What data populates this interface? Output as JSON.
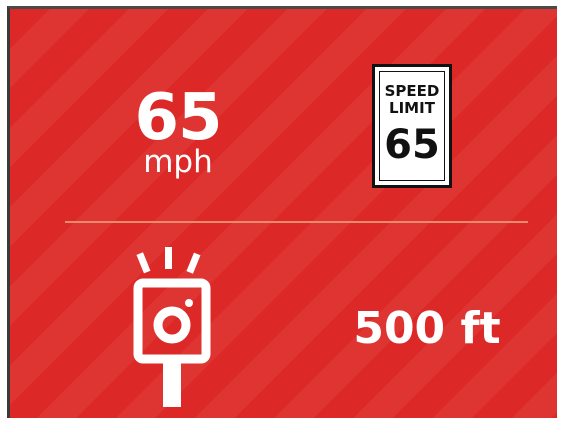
{
  "current_speed": {
    "value": "65",
    "unit": "mph"
  },
  "speed_limit_sign": {
    "line1": "SPEED",
    "line2": "LIMIT",
    "value": "65"
  },
  "alert": {
    "icon": "speed-camera-icon",
    "distance": "500 ft"
  },
  "colors": {
    "background": "#dc2826",
    "text": "#ffffff",
    "divider": "#e98a6c",
    "sign_background": "#ffffff",
    "sign_text": "#111111"
  }
}
